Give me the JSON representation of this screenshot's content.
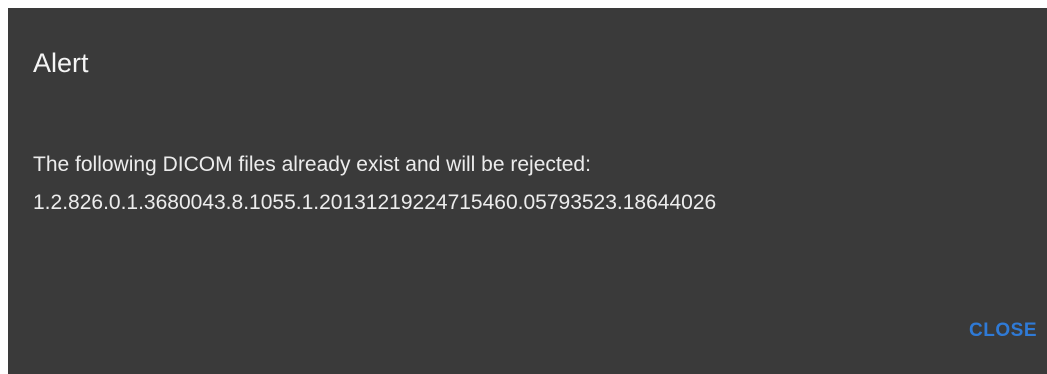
{
  "dialog": {
    "title": "Alert",
    "message_line_1": "The following DICOM files already exist and will be rejected:",
    "message_line_2": "1.2.826.0.1.3680043.8.1055.1.20131219224715460.05793523.18644026",
    "close_label": "CLOSE"
  },
  "colors": {
    "dialog_background": "#3a3a3a",
    "text": "#ececec",
    "accent": "#2f7ad6"
  }
}
